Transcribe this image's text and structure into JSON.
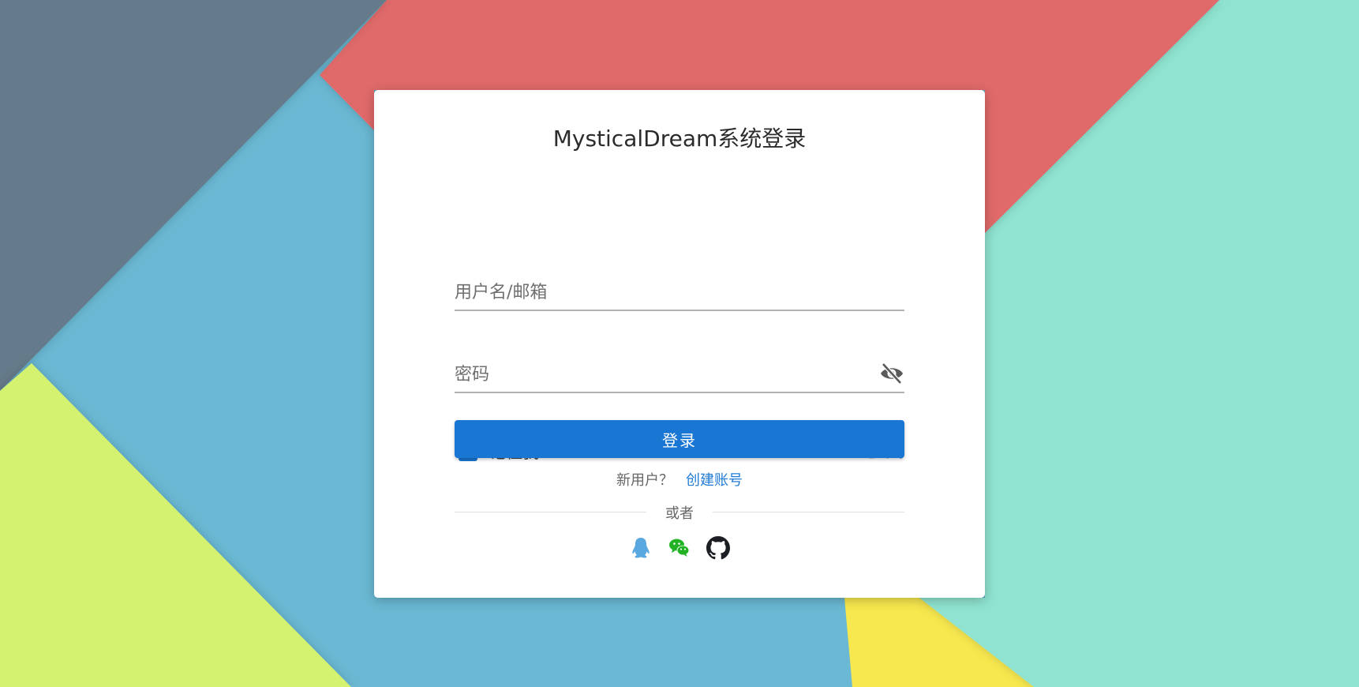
{
  "colors": {
    "primary": "#1976d2",
    "link": "#1f7bd6",
    "background_slate": "#657a8a",
    "background_red": "#e06b6b",
    "background_blue": "#6ab8d3",
    "background_mint": "#8fe3d0",
    "background_lime": "#d4f270",
    "background_yellow": "#f7e84f"
  },
  "login": {
    "title": "MysticalDream系统登录",
    "username_placeholder": "用户名/邮箱",
    "password_placeholder": "密码",
    "password_toggle_icon": "eye-off-icon",
    "remember_checked": true,
    "remember_label": "记住我",
    "forgot_password": "忘记密码",
    "submit_label": "登录",
    "signup_prompt": "新用户？",
    "signup_link": "创建账号",
    "divider_text": "或者",
    "social_icons": [
      "qq-icon",
      "wechat-icon",
      "github-icon"
    ]
  }
}
